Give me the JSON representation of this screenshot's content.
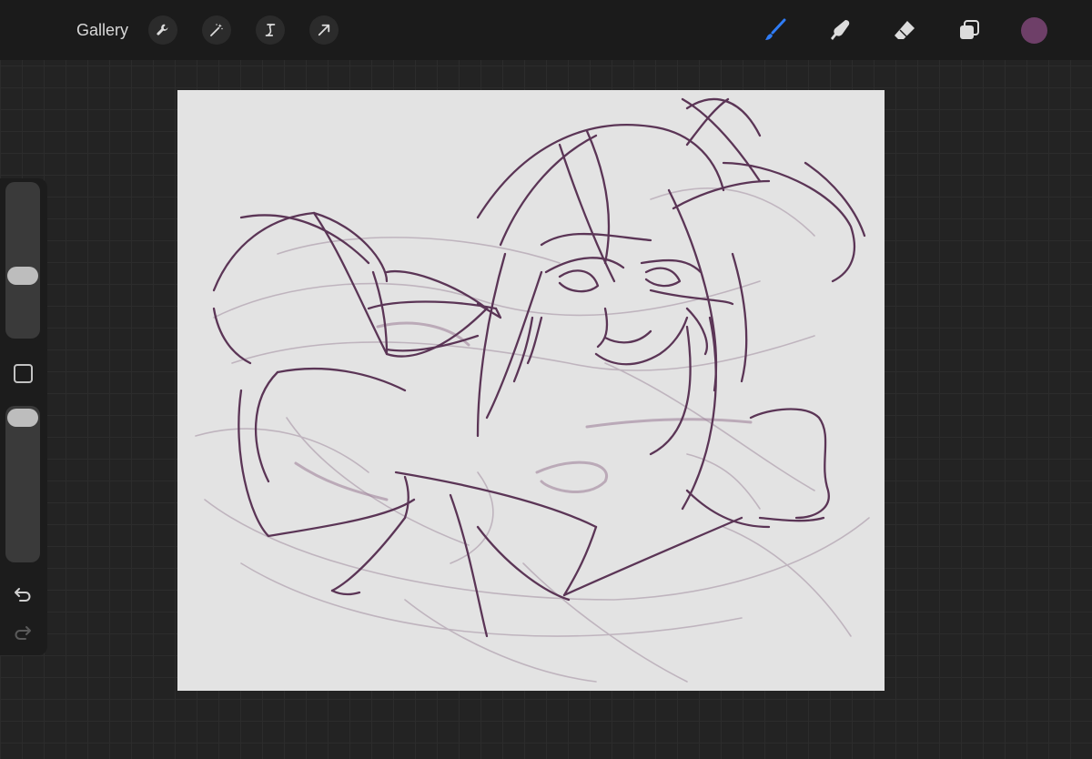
{
  "topbar": {
    "gallery_label": "Gallery",
    "left_tools": [
      {
        "name": "actions",
        "icon": "wrench-icon"
      },
      {
        "name": "adjustments",
        "icon": "magic-wand-icon"
      },
      {
        "name": "selection",
        "icon": "selection-s-icon"
      },
      {
        "name": "transform",
        "icon": "arrow-cursor-icon"
      }
    ],
    "right_tools": [
      {
        "name": "brush",
        "icon": "brush-icon",
        "active": true
      },
      {
        "name": "smudge",
        "icon": "smudge-finger-icon",
        "active": false
      },
      {
        "name": "eraser",
        "icon": "eraser-icon",
        "active": false
      },
      {
        "name": "layers",
        "icon": "layers-icon",
        "active": false
      }
    ],
    "current_color": "#6e3f68"
  },
  "sidebar": {
    "brush_size_level": 0.57,
    "opacity_level": 1.0,
    "modify_button_icon": "square-outline-icon",
    "undo_icon": "undo-arrow-icon",
    "redo_icon": "redo-arrow-icon"
  },
  "colors": {
    "accent": "#2f7cf6",
    "stroke": "#5b3556",
    "sketch_light": "#b9adb8",
    "canvas_bg": "#e3e3e3"
  }
}
